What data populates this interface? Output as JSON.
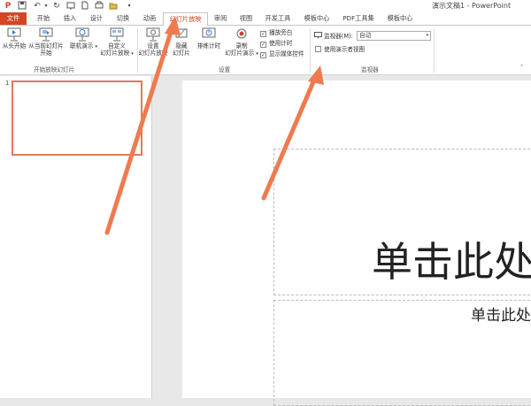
{
  "window": {
    "title": "演示文稿1 - PowerPoint"
  },
  "tabs": [
    {
      "label": "文件"
    },
    {
      "label": "开始"
    },
    {
      "label": "插入"
    },
    {
      "label": "设计"
    },
    {
      "label": "切换"
    },
    {
      "label": "动画"
    },
    {
      "label": "幻灯片放映"
    },
    {
      "label": "审阅"
    },
    {
      "label": "视图"
    },
    {
      "label": "开发工具"
    },
    {
      "label": "模板中心"
    },
    {
      "label": "PDF工具集"
    },
    {
      "label": "模板中心"
    }
  ],
  "ribbon": {
    "from_beginning": "从头开始",
    "from_current_1": "从当前幻灯片",
    "from_current_2": "开始",
    "online_present": "联机演示",
    "custom_1": "自定义",
    "custom_2": "幻灯片放映",
    "group_start": "开始放映幻灯片",
    "setup_1": "设置",
    "setup_2": "幻灯片放映",
    "hide_1": "隐藏",
    "hide_2": "幻灯片",
    "rehearse": "排练计时",
    "record_1": "录制",
    "record_2": "幻灯片演示",
    "chk_narration": "播放旁白",
    "chk_timing": "使用计时",
    "chk_media": "显示媒体控件",
    "group_setup": "设置",
    "monitor_label": "监视器(M):",
    "monitor_value": "自动",
    "presenter_view": "使用演示者视图",
    "group_monitors": "监视器"
  },
  "slides": {
    "thumb_number": "1"
  },
  "slide": {
    "title_placeholder": "单击此处",
    "subtitle_placeholder": "单击此处"
  },
  "colors": {
    "accent": "#d24625",
    "arrow": "#f07a4f"
  }
}
